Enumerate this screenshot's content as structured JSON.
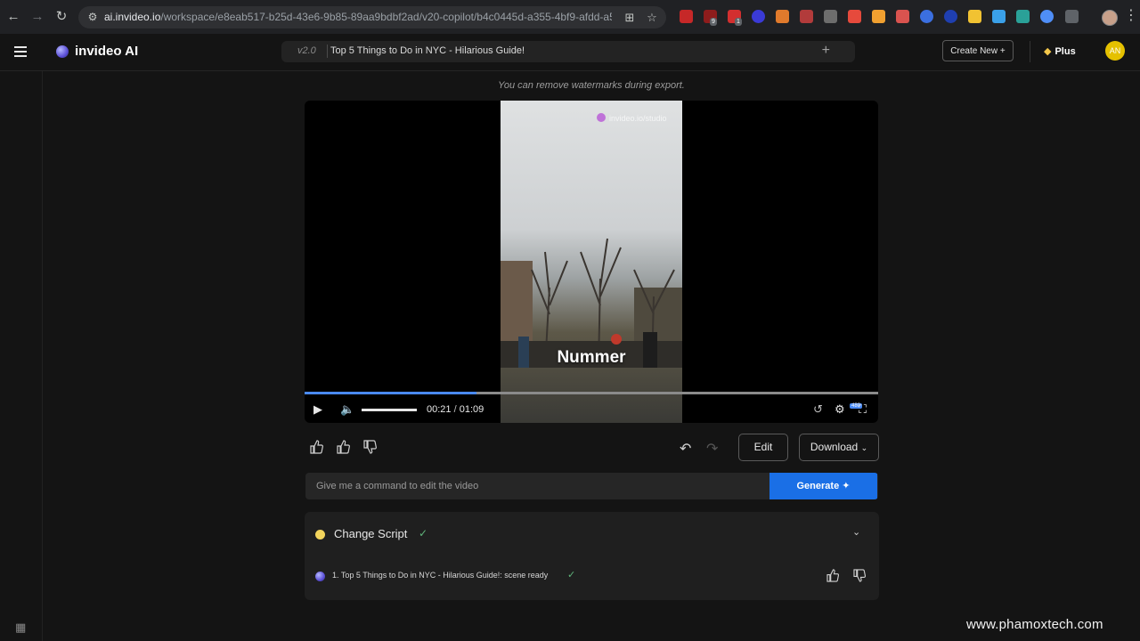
{
  "browser": {
    "url_host": "ai.invideo.io",
    "url_path": "/workspace/e8eab517-b25d-43e6-9b85-89aa9bdbf2ad/v20-copilot/b4c0445d-a355-4bf9-afdd-a5...",
    "ext_badges": [
      "9",
      "1"
    ]
  },
  "header": {
    "brand": "invideo AI",
    "version": "v2.0",
    "project_title": "Top 5 Things to Do in NYC - Hilarious Guide!",
    "create_new": "Create New",
    "plan": "Plus",
    "avatar_initials": "AN"
  },
  "notice": "You can remove watermarks during export.",
  "player": {
    "caption": "Nummer",
    "current_time": "00:21",
    "duration": "01:09",
    "progress": 0.3,
    "quality": "480",
    "watermark_text": "invideo.io/studio"
  },
  "toolbar": {
    "edit": "Edit",
    "download": "Download"
  },
  "command": {
    "placeholder": "Give me a command to edit the video",
    "generate": "Generate"
  },
  "script_card": {
    "heading": "Change Script",
    "scene_status": "1. Top 5 Things to Do in NYC - Hilarious Guide!: scene ready"
  },
  "site_watermark": "www.phamoxtech.com",
  "colors": {
    "accent": "#1a6fe6",
    "progress": "#4a8af4",
    "success": "#5fb37a",
    "avatar": "#e5c100"
  }
}
